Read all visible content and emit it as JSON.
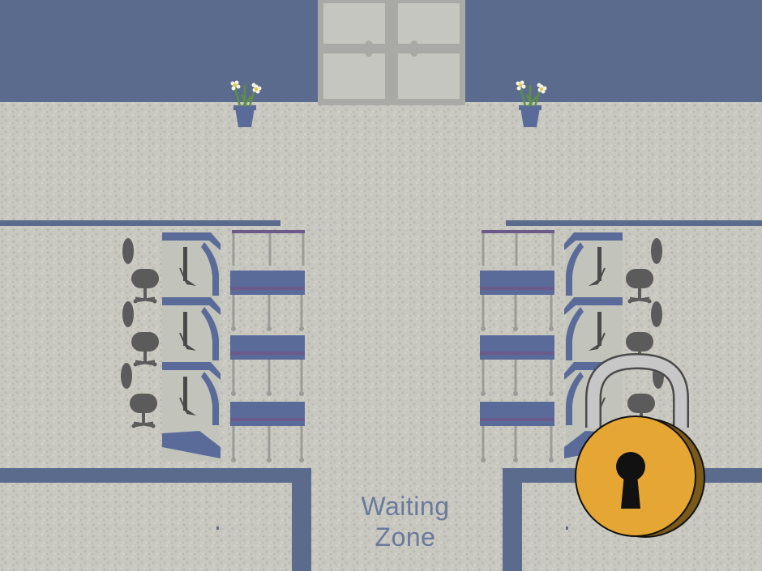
{
  "scene": {
    "waiting_zone_label_line1": "Waiting",
    "waiting_zone_label_line2": "Zone"
  },
  "colors": {
    "wall": "#5a6b8d",
    "carpet": "#c8c8c0",
    "carpet_dark": "#babab1",
    "door_glass": "#c6c6c0",
    "door_frame": "#a9a9a6",
    "chair": "#5b5b5b",
    "desk_panel": "#5a6b9a",
    "desk_top": "#c2c3bb",
    "monitor": "#4a4a4a",
    "pot": "#5a6b9a",
    "flower": "#f4f4e0",
    "flower_center": "#e7c63e",
    "lock_body": "#e6a633",
    "lock_side": "#7a5a1a",
    "lock_shackle": "#c7c7c7",
    "keyhole": "#111111"
  },
  "icons": {
    "door": "double-door-icon",
    "plant": "potted-plant-icon",
    "chair": "office-chair-icon",
    "monitor": "computer-monitor-icon",
    "lock": "padlock-locked-icon"
  }
}
